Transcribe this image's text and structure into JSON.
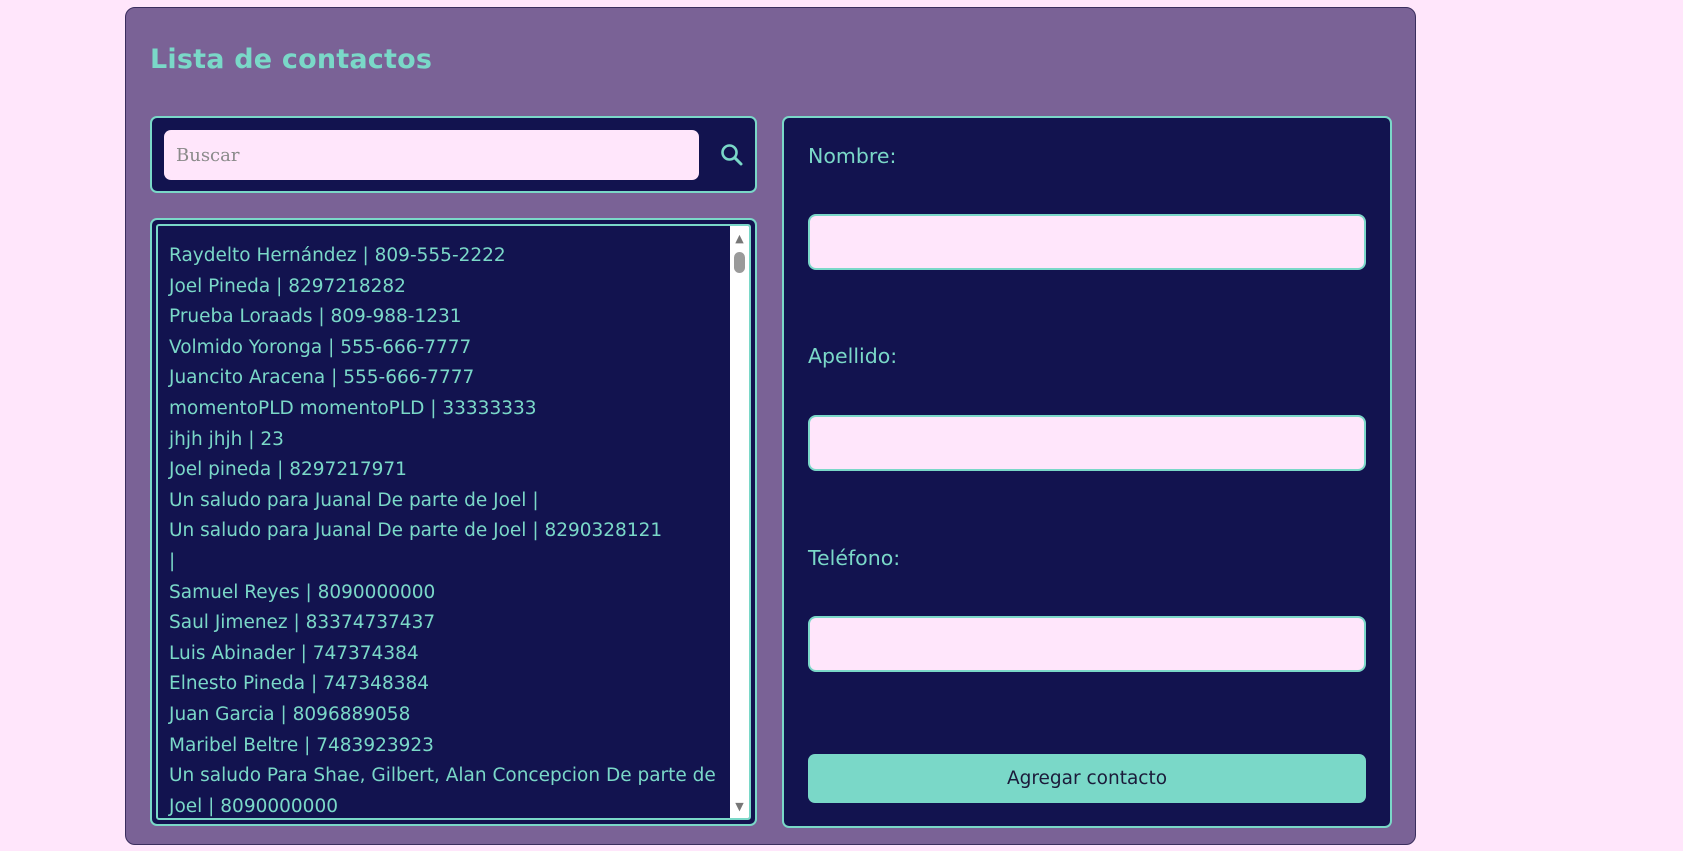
{
  "app": {
    "title": "Lista de contactos"
  },
  "search": {
    "placeholder": "Buscar",
    "value": "",
    "icon": "search-icon"
  },
  "contacts": [
    "Raydelto Hernández | 809-555-2222",
    "Joel Pineda | 8297218282",
    "Prueba Loraads | 809-988-1231",
    "Volmido Yoronga | 555-666-7777",
    "Juancito Aracena | 555-666-7777",
    "momentoPLD momentoPLD | 33333333",
    "jhjh jhjh | 23",
    "Joel pineda | 8297217971",
    "Un saludo para Juanal De parte de Joel |",
    "Un saludo para Juanal De parte de Joel | 8290328121",
    "|",
    "Samuel Reyes | 8090000000",
    "Saul Jimenez | 83374737437",
    "Luis Abinader | 747374384",
    "Elnesto Pineda | 747348384",
    "Juan Garcia | 8096889058",
    "Maribel Beltre | 7483923923",
    "Un saludo Para Shae, Gilbert, Alan Concepcion De parte de",
    "Joel | 8090000000"
  ],
  "form": {
    "nombre_label": "Nombre:",
    "nombre_value": "",
    "apellido_label": "Apellido:",
    "apellido_value": "",
    "telefono_label": "Teléfono:",
    "telefono_value": "",
    "submit_label": "Agregar contacto"
  },
  "colors": {
    "page_background": "#ffe6fb",
    "card_background": "#7a6296",
    "panel_background": "#12134f",
    "accent": "#7ad8c8"
  }
}
